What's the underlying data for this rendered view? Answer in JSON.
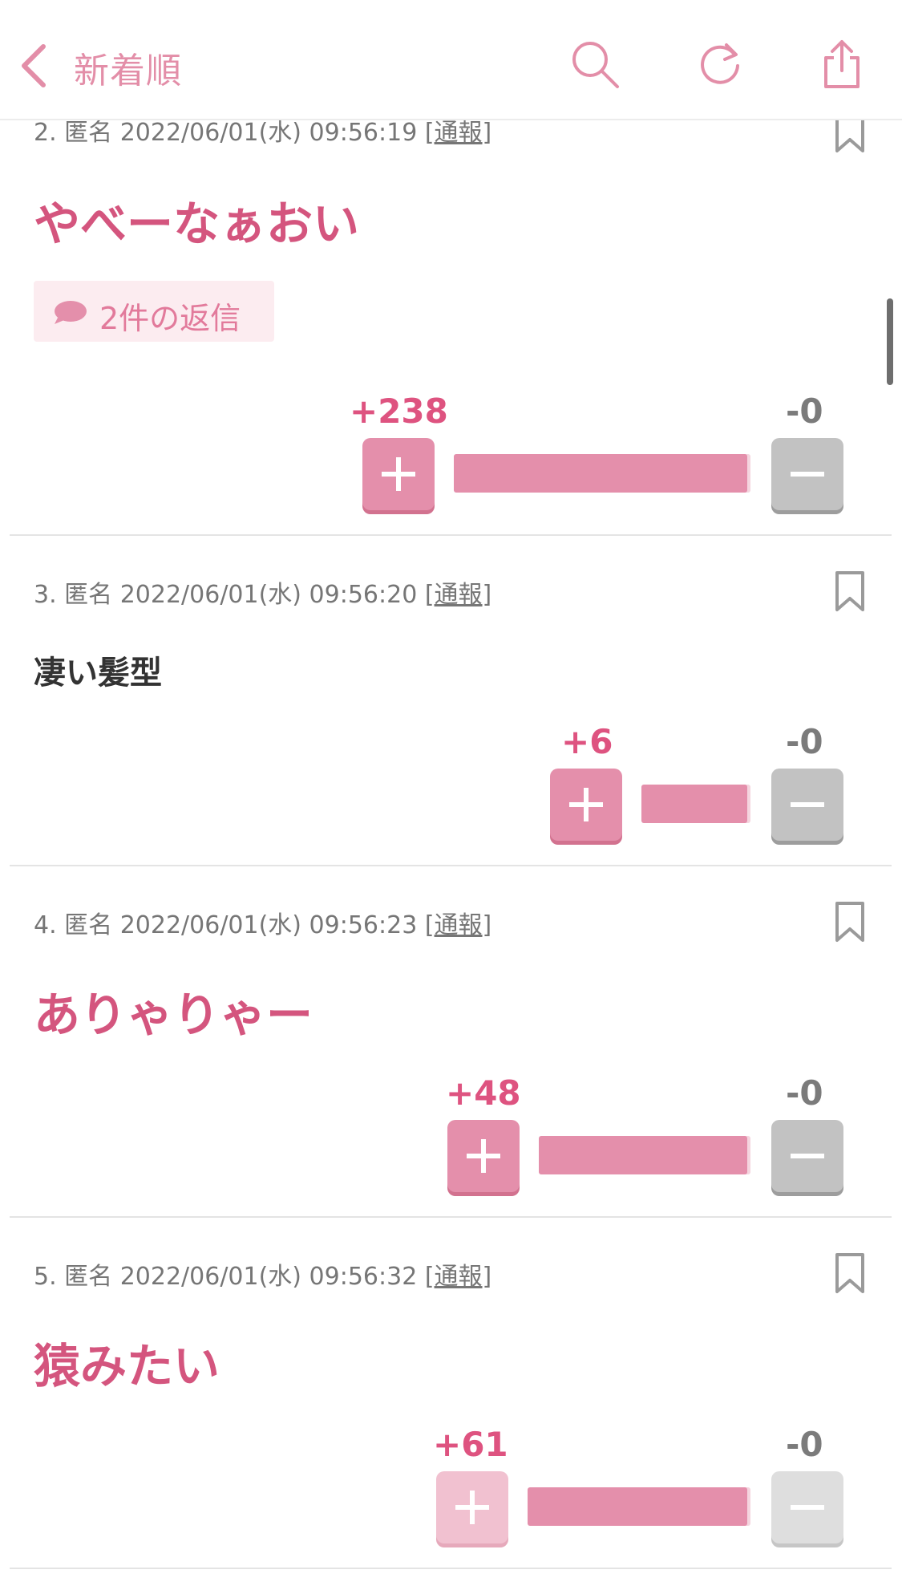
{
  "header": {
    "title": "新着順",
    "icons": [
      "back-icon",
      "search-icon",
      "reload-icon",
      "share-icon"
    ],
    "accent_color": "#e38ea8"
  },
  "comments": [
    {
      "meta_prefix": "2. 匿名 2022/06/01(水) 09:56:19 [",
      "report": "通報",
      "meta_suffix": "]",
      "text": "やべーなぁおい",
      "replies": "2件の返信",
      "plus": "+238",
      "minus": "-0",
      "ratio": 1.0
    },
    {
      "meta_prefix": "3. 匿名 2022/06/01(水) 09:56:20 [",
      "report": "通報",
      "meta_suffix": "]",
      "text": "凄い髪型",
      "plus": "+6",
      "minus": "-0",
      "ratio": 1.0
    },
    {
      "meta_prefix": "4. 匿名 2022/06/01(水) 09:56:23 [",
      "report": "通報",
      "meta_suffix": "]",
      "text": "ありゃりゃー",
      "plus": "+48",
      "minus": "-0",
      "ratio": 1.0
    },
    {
      "meta_prefix": "5. 匿名 2022/06/01(水) 09:56:32 [",
      "report": "通報",
      "meta_suffix": "]",
      "text": "猿みたい",
      "plus": "+61",
      "minus": "-0",
      "ratio": 1.0
    }
  ],
  "colors": {
    "plus": "#e48fab",
    "minus": "#c2c2c2",
    "text_pink": "#d4557e"
  }
}
